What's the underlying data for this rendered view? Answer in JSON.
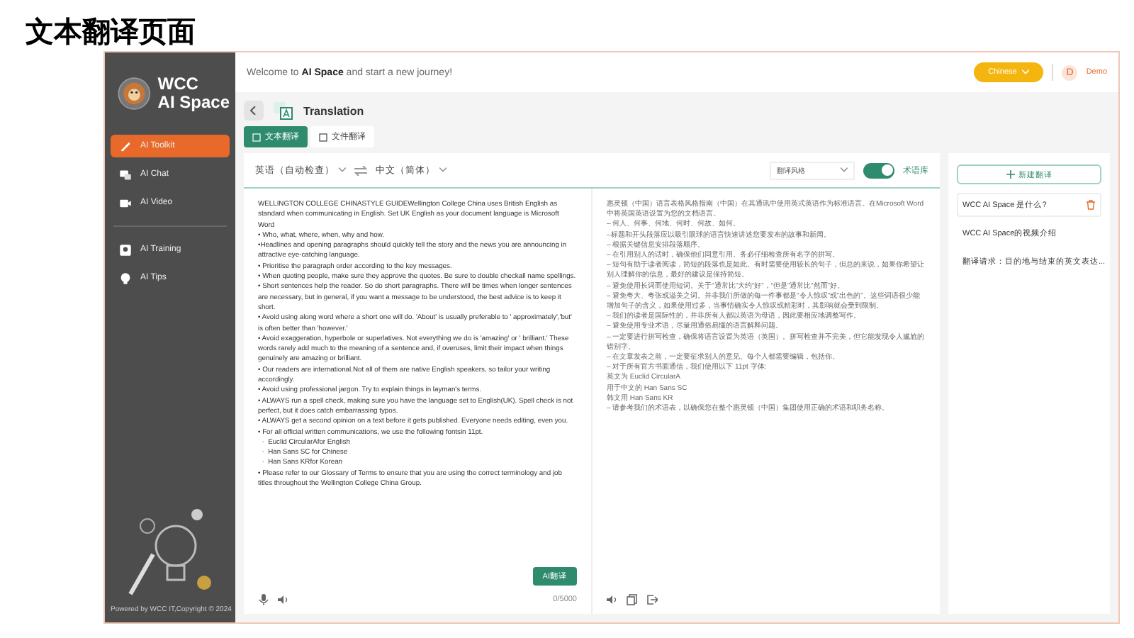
{
  "page_title": "文本翻译页面",
  "sidebar": {
    "logo_lines": [
      "WCC",
      "AI Space"
    ],
    "groups": [
      [
        {
          "label": "AI Toolkit",
          "selected": true
        },
        {
          "label": "AI Chat",
          "selected": false
        },
        {
          "label": "AI Video",
          "selected": false
        }
      ],
      [
        {
          "label": "AI Training",
          "selected": false
        },
        {
          "label": "AI Tips",
          "selected": false
        }
      ]
    ],
    "footer": "Powered by WCC IT,Copyright © 2024"
  },
  "header": {
    "welcome": "Welcome to **AI Space** and start a new journey!",
    "language": "Chinese",
    "user_initial": "D",
    "user_name": "Demo"
  },
  "page": {
    "title": "Translation",
    "tabs": [
      {
        "label": "文本翻译",
        "selected": true
      },
      {
        "label": "文件翻译",
        "selected": false
      }
    ]
  },
  "translator": {
    "source_language": "英语（自动检查）",
    "target_language": "中文（简体）",
    "style_placeholder": "翻译风格",
    "glossary": {
      "label": "术语库",
      "on": true
    },
    "source_lines": [
      "WELLINGTON COLLEGE CHINASTYLE GUIDEWellington College China uses British English as standard when communicating in English. Set UK English as your document language is Microsoft Word",
      "• Who, what, where, when, why and how.",
      "•Headlines and opening paragraphs should quickly tell the story and the news you are announcing in attractive eye-catching language.",
      "• Prioritise the paragraph order according to the key messages.",
      "• When quoting people, make sure they approve the quotes. Be sure to double checkall name spellings.",
      "• Short sentences help the reader. So do short paragraphs. There will be times when longer sentences are necessary, but in general, if you want a message to be understood, the best advice is to keep it short.",
      "• Avoid using along word where a short one will do. 'About' is usually preferable to ' approximately','but' is often better than 'however.'",
      "• Avoid exaggeration, hyperbole or superlatives. Not everything we do is 'amazing' or ' brilliant.' These words rarely add much to the meaning of a sentence and, if overuses, limit their impact when things genuinely are amazing or brilliant.",
      "• Our readers are international.Not all of them are native English speakers, so tailor your writing accordingly.",
      "• Avoid using professional jargon. Try to explain things in layman's terms.",
      "• ALWAYS run a spell check, making sure you have the language set to English(UK). Spell check is not perfect, but it does catch embarrassing typos.",
      "• ALWAYS get a second opinion on a text before it gets published. Everyone needs editing, even you.",
      "• For all official written communications, we use the following fontsin 11pt.",
      "  ·  Euclid CircularAfor English",
      "  ·  Han Sans SC for Chinese",
      "  ·  Han Sans KRfor Korean",
      "• Please refer to our Glossary of Terms to ensure that you are using the correct terminology and job titles throughout the Wellington College China Group."
    ],
    "translate_button": "AI翻译",
    "char_count": "0/5000",
    "target_lines": [
      "惠灵顿（中国）语言表格风格指南（中国）在其通讯中使用英式英语作为标准语言。在Microsoft Word 中将英国英语设置为您的文档语言。",
      "– 何人、何事、何地、何时、何故、如何。",
      "–标题和开头段落应以吸引眼球的语言快速讲述您要发布的故事和新闻。",
      "– 根据关键信息安排段落顺序。",
      "– 在引用别人的话时，确保他们同意引用。务必仔细检查所有名字的拼写。",
      "– 短句有助于读者阅读，简短的段落也是如此。有时需要使用较长的句子，但总的来说，如果你希望让别人理解你的信息，最好的建议是保持简短。",
      "– 避免使用长词而使用短词。关于“通常比”大约“好”，“但是”通常比“然而”好。",
      "– 避免夸大、夸张或溢美之词。并非我们所做的每一件事都是“令人惊叹”或“出色的”。这些词语很少能增加句子的含义，如果使用过多，当事情确实令人惊叹或精彩时，其影响就会受到限制。",
      "– 我们的读者是国际性的，并非所有人都以英语为母语，因此要相应地调整写作。",
      "– 避免使用专业术语，尽量用通俗易懂的语言解释问题。",
      "– 一定要进行拼写检查，确保将语言设置为英语（英国）。拼写检查并不完美，但它能发现令人尴尬的错别字。",
      "– 在文章发表之前，一定要征求别人的意见。每个人都需要编辑，包括你。",
      "– 对于所有官方书面通信，我们使用以下 11pt 字体:",
      "英文为 Euclid CircularA",
      "用于中文的 Han Sans SC",
      "韩文用 Han Sans KR",
      "– 请参考我们的术语表，以确保您在整个惠灵顿（中国）集团使用正确的术语和职务名称。"
    ]
  },
  "history": {
    "new_button": "新建翻译",
    "items": [
      {
        "label": "WCC AI Space 是什么?",
        "selected": true
      },
      {
        "label": "WCC AI Space的视频介绍",
        "selected": false
      },
      {
        "label": "翻译请求：目的地与结束的英文表达...",
        "selected": false
      }
    ]
  }
}
